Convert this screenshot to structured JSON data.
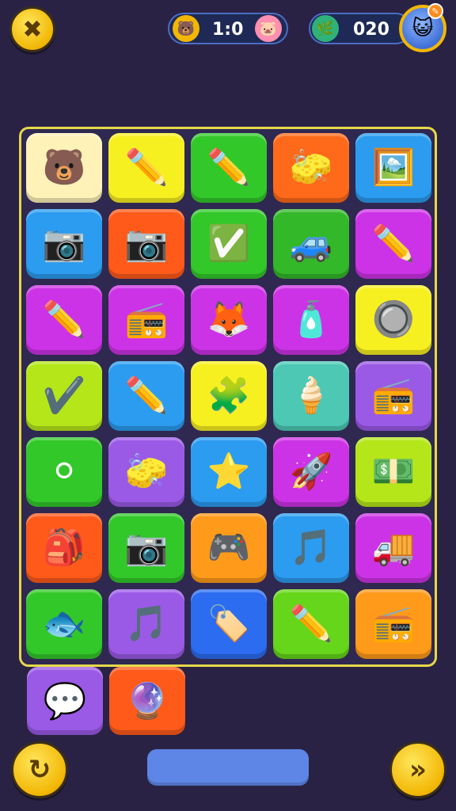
{
  "top_bar": {
    "close_icon": "✖",
    "score": {
      "text": "1:0",
      "left_icon": "🐻",
      "right_icon": "🐷"
    },
    "coins": {
      "text": "020",
      "icon": "🌿"
    },
    "avatar_icon": "😺",
    "avatar_badge": "✎"
  },
  "board": {
    "tiles": [
      {
        "icon": "🐻",
        "color": "#fff2b8",
        "name": "bear-icon"
      },
      {
        "icon": "✏️",
        "color": "#f7f020",
        "name": "eraser-icon"
      },
      {
        "icon": "✏️",
        "color": "#33c82a",
        "name": "pencil-icon"
      },
      {
        "icon": "🧽",
        "color": "#ff6a1a",
        "name": "eraser-icon"
      },
      {
        "icon": "🖼️",
        "color": "#2b9cf0",
        "name": "picture-icon"
      },
      {
        "icon": "📷",
        "color": "#2b9cf0",
        "name": "camera-icon"
      },
      {
        "icon": "📷",
        "color": "#ff5a1a",
        "name": "camera-icon"
      },
      {
        "icon": "✅",
        "color": "#33c82a",
        "name": "check-card-icon"
      },
      {
        "icon": "🚙",
        "color": "#33b82a",
        "name": "car-icon"
      },
      {
        "icon": "✏️",
        "color": "#cc33e6",
        "name": "pencil-icon"
      },
      {
        "icon": "✏️",
        "color": "#cc33e6",
        "name": "pencil-icon"
      },
      {
        "icon": "📻",
        "color": "#cc33e6",
        "name": "radio-icon"
      },
      {
        "icon": "🦊",
        "color": "#cc33e6",
        "name": "fox-icon"
      },
      {
        "icon": "🧴",
        "color": "#cc33e6",
        "name": "glue-icon"
      },
      {
        "icon": "🔘",
        "color": "#f7f020",
        "name": "toggle-icon"
      },
      {
        "icon": "✔️",
        "color": "#b4e61a",
        "name": "check-icon"
      },
      {
        "icon": "✏️",
        "color": "#2b9cf0",
        "name": "pencil-icon"
      },
      {
        "icon": "🧩",
        "color": "#f7f020",
        "name": "puzzle-icon"
      },
      {
        "icon": "🍦",
        "color": "#4cc8b4",
        "name": "ice-cream-icon"
      },
      {
        "icon": "📻",
        "color": "#9a5ae6",
        "name": "radio-icon"
      },
      {
        "icon": "⚪",
        "color": "#33c82a",
        "name": "ball-icon"
      },
      {
        "icon": "🧽",
        "color": "#9a5ae6",
        "name": "eraser-icon"
      },
      {
        "icon": "⭐",
        "color": "#2b9cf0",
        "name": "star-icon"
      },
      {
        "icon": "🚀",
        "color": "#cc33e6",
        "name": "rocket-icon"
      },
      {
        "icon": "💵",
        "color": "#b4e61a",
        "name": "cash-icon"
      },
      {
        "icon": "🎒",
        "color": "#ff5a1a",
        "name": "bag-icon"
      },
      {
        "icon": "📷",
        "color": "#33c82a",
        "name": "camera-icon"
      },
      {
        "icon": "🎮",
        "color": "#ff9a1a",
        "name": "console-icon"
      },
      {
        "icon": "🎵",
        "color": "#2b9cf0",
        "name": "music-icon"
      },
      {
        "icon": "🚚",
        "color": "#cc33e6",
        "name": "truck-icon"
      },
      {
        "icon": "🐟",
        "color": "#33c82a",
        "name": "fish-icon"
      },
      {
        "icon": "🎵",
        "color": "#9a5ae6",
        "name": "music-card-icon"
      },
      {
        "icon": "🏷️",
        "color": "#2b6cf0",
        "name": "tag-icon"
      },
      {
        "icon": "✏️",
        "color": "#66d61a",
        "name": "pencil-icon"
      },
      {
        "icon": "📻",
        "color": "#ff9a1a",
        "name": "radio-icon"
      }
    ]
  },
  "slot": {
    "tiles": [
      {
        "icon": "💬",
        "color": "#9a5ae6",
        "name": "speech-bubble-icon"
      },
      {
        "icon": "🔮",
        "color": "#ff5a1a",
        "name": "charm-icon"
      }
    ]
  },
  "bottom_bar": {
    "undo_icon": "↻",
    "next_icon": "»"
  }
}
